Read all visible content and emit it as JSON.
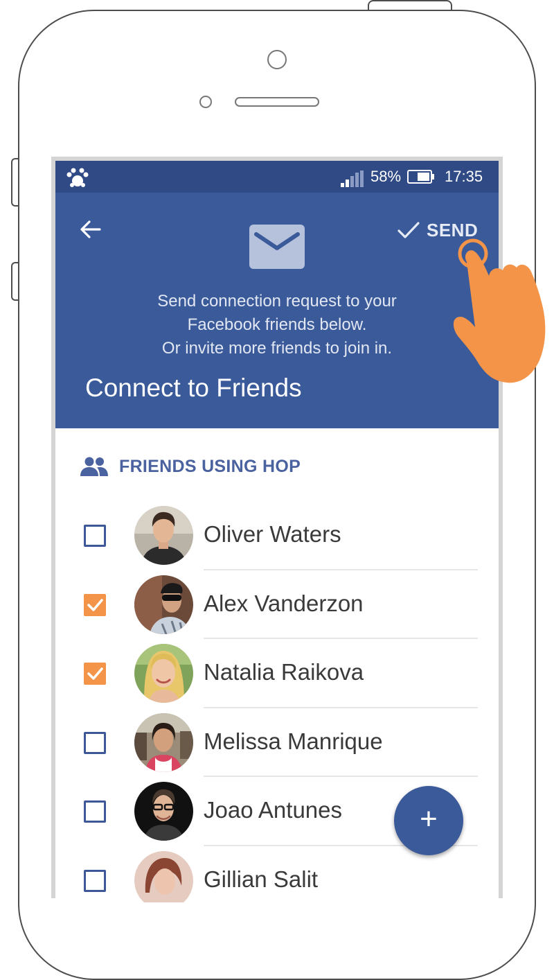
{
  "statusbar": {
    "battery": "58%",
    "time": "17:35"
  },
  "header": {
    "send_label": "SEND",
    "message_lines": [
      "Send connection request to your",
      "Facebook friends below.",
      "Or invite more friends to join in."
    ],
    "title": "Connect to Friends"
  },
  "section": {
    "label": "FRIENDS USING HOP"
  },
  "friends": [
    {
      "name": "Oliver Waters",
      "checked": false
    },
    {
      "name": "Alex Vanderzon",
      "checked": true
    },
    {
      "name": "Natalia Raikova",
      "checked": true
    },
    {
      "name": "Melissa Manrique",
      "checked": false
    },
    {
      "name": "Joao Antunes",
      "checked": false
    },
    {
      "name": "Gillian Salit",
      "checked": false
    }
  ],
  "fab": {
    "label": "+"
  },
  "colors": {
    "statusbar": "#2f4a84",
    "header": "#3b5a9a",
    "accent_orange": "#f39448",
    "section_text": "#4b62a0"
  },
  "icons": [
    "hop-logo-icon",
    "signal-icon",
    "battery-icon",
    "back-arrow-icon",
    "envelope-icon",
    "check-icon",
    "people-icon",
    "plus-icon",
    "hand-pointer-icon"
  ]
}
